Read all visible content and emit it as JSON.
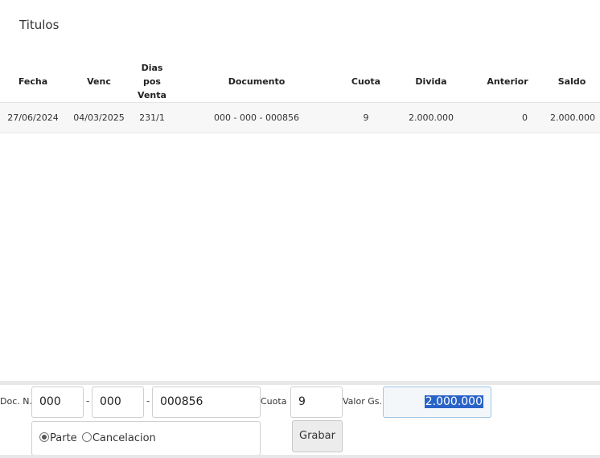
{
  "section_title": "Titulos",
  "table": {
    "headers": {
      "fecha": "Fecha",
      "venc": "Venc",
      "dias_line1": "Dias pos",
      "dias_line2": "Venta",
      "documento": "Documento",
      "cuota": "Cuota",
      "divida": "Divida",
      "anterior": "Anterior",
      "saldo": "Saldo"
    },
    "rows": [
      {
        "fecha": "27/06/2024",
        "venc": "04/03/2025",
        "dias": "231/1",
        "documento": "000 - 000 - 000856",
        "cuota": "9",
        "divida": "2.000.000",
        "anterior": "0",
        "saldo": "2.000.000"
      }
    ]
  },
  "form": {
    "doc_label": "Doc. N.:",
    "doc_part1": "000",
    "doc_part2": "000",
    "doc_part3": "000856",
    "dash": "-",
    "cuota_label": "Cuota :",
    "cuota_value": "9",
    "valor_label": "Valor Gs.:",
    "valor_value": "2.000.000",
    "radio_parte": "Parte",
    "radio_cancelacion": "Cancelacion",
    "selected_option": "Parte",
    "save_label": "Grabar"
  }
}
